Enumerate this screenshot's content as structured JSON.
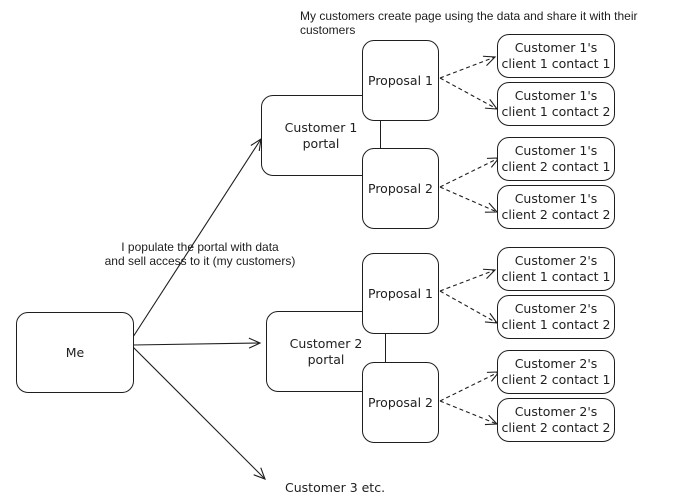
{
  "annotations": {
    "top": "My customers create page using the data and share it with their customers",
    "middle": "I populate the portal with data\nand sell access to it (my customers)",
    "bottom": "Customer 3 etc."
  },
  "nodes": {
    "me": "Me",
    "customer1_portal": "Customer 1\nportal",
    "customer2_portal": "Customer 2\nportal",
    "c1_proposal1": "Proposal 1",
    "c1_proposal2": "Proposal 2",
    "c2_proposal1": "Proposal 1",
    "c2_proposal2": "Proposal 2",
    "c1_p1_contact1": "Customer 1's\nclient 1 contact 1",
    "c1_p1_contact2": "Customer 1's\nclient 1 contact 2",
    "c1_p2_contact1": "Customer 1's\nclient 2 contact 1",
    "c1_p2_contact2": "Customer 1's\nclient 2 contact 2",
    "c2_p1_contact1": "Customer 2's\nclient 1 contact 1",
    "c2_p1_contact2": "Customer 2's\nclient 1 contact 2",
    "c2_p2_contact1": "Customer 2's\nclient 2 contact 1",
    "c2_p2_contact2": "Customer 2's\nclient 2 contact 2"
  },
  "edges": [
    {
      "from": "me",
      "to": "customer1_portal",
      "style": "solid-arrow"
    },
    {
      "from": "me",
      "to": "customer2_portal",
      "style": "solid-arrow"
    },
    {
      "from": "me",
      "to": "customer3",
      "style": "solid-arrow"
    },
    {
      "from": "customer1_portal",
      "to": "c1_proposal1",
      "style": "line"
    },
    {
      "from": "c1_proposal1",
      "to": "c1_proposal2",
      "style": "line"
    },
    {
      "from": "customer2_portal",
      "to": "c2_proposal1",
      "style": "line"
    },
    {
      "from": "c2_proposal1",
      "to": "c2_proposal2",
      "style": "line"
    },
    {
      "from": "c1_proposal1",
      "to": "c1_p1_contact1",
      "style": "dashed-arrow"
    },
    {
      "from": "c1_proposal1",
      "to": "c1_p1_contact2",
      "style": "dashed-arrow"
    },
    {
      "from": "c1_proposal2",
      "to": "c1_p2_contact1",
      "style": "dashed-arrow"
    },
    {
      "from": "c1_proposal2",
      "to": "c1_p2_contact2",
      "style": "dashed-arrow"
    },
    {
      "from": "c2_proposal1",
      "to": "c2_p1_contact1",
      "style": "dashed-arrow"
    },
    {
      "from": "c2_proposal1",
      "to": "c2_p1_contact2",
      "style": "dashed-arrow"
    },
    {
      "from": "c2_proposal2",
      "to": "c2_p2_contact1",
      "style": "dashed-arrow"
    },
    {
      "from": "c2_proposal2",
      "to": "c2_p2_contact2",
      "style": "dashed-arrow"
    }
  ]
}
